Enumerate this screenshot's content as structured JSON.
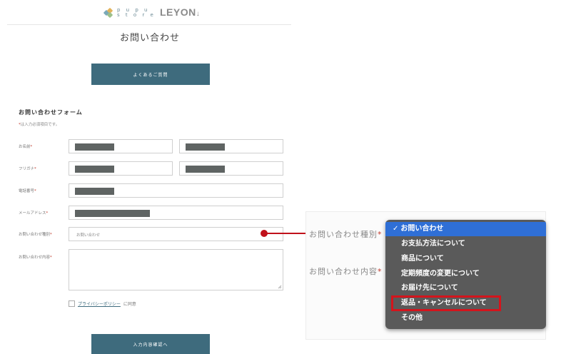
{
  "header": {
    "pupu_logo_text": "pupu store",
    "pupu_line1": "p u p u",
    "pupu_line2": "s t o r e",
    "leyon_logo_text": "LEYON"
  },
  "page": {
    "title": "お問い合わせ"
  },
  "faq_button": {
    "label": "よくあるご質問"
  },
  "form": {
    "title": "お問い合わせフォーム",
    "required_note_star": "*",
    "required_note": "は入力必須項目です。",
    "fields": {
      "name": {
        "label": "お名前",
        "star": "*"
      },
      "furigana": {
        "label": "フリガナ",
        "star": "*"
      },
      "phone": {
        "label": "電話番号",
        "star": "*"
      },
      "email": {
        "label": "メールアドレス",
        "star": "*"
      },
      "inquiry_type": {
        "label": "お問い合わせ種別",
        "star": "*",
        "value": "お問い合わせ"
      },
      "inquiry_content": {
        "label": "お問い合わせ内容",
        "star": "*"
      }
    },
    "privacy": {
      "link": "プライバシーポリシー",
      "rest": "に同意"
    },
    "submit_label": "入力内容確認へ"
  },
  "callout": {
    "inquiry_type_label": "お問い合わせ種別",
    "inquiry_content_label": "お問い合わせ内容",
    "star": "*",
    "options": [
      "お問い合わせ",
      "お支払方法について",
      "商品について",
      "定期頻度の変更について",
      "お届け先について",
      "返品・キャンセルについて",
      "その他"
    ],
    "selected_index": 0,
    "highlighted_index": 5
  },
  "colors": {
    "accent": "#3e6b7d",
    "highlight": "#d4141c",
    "dropdown_bg": "#5a5a5a",
    "dropdown_selected": "#2f6fd6"
  }
}
